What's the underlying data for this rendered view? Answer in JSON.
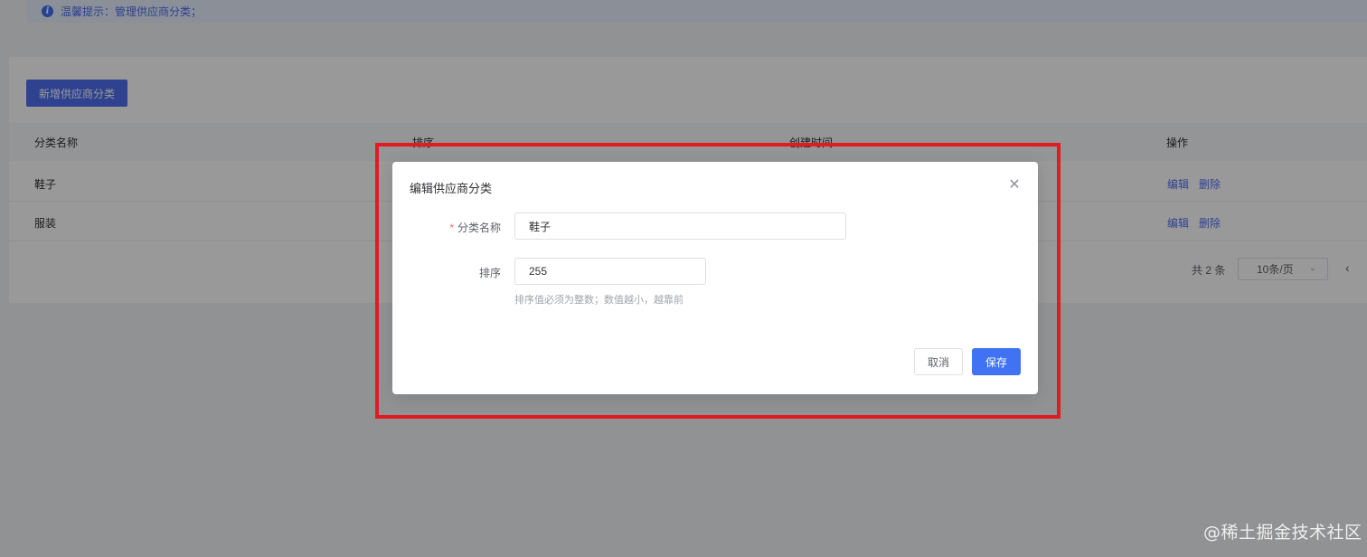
{
  "alert": {
    "text": "温馨提示：管理供应商分类；"
  },
  "toolbar": {
    "add_label": "新增供应商分类"
  },
  "table": {
    "columns": [
      "分类名称",
      "排序",
      "创建时间",
      "操作"
    ],
    "rows": [
      {
        "name": "鞋子",
        "edit": "编辑",
        "delete": "删除"
      },
      {
        "name": "服装",
        "edit": "编辑",
        "delete": "删除"
      }
    ]
  },
  "pagination": {
    "total": "共 2 条",
    "page_size": "10条/页"
  },
  "modal": {
    "title": "编辑供应商分类",
    "name_label": "分类名称",
    "name_value": "鞋子",
    "sort_label": "排序",
    "sort_value": "255",
    "sort_hint": "排序值必须为整数；数值越小，越靠前",
    "cancel_label": "取消",
    "save_label": "保存"
  },
  "watermark": "@稀土掘金技术社区",
  "colors": {
    "primary": "#4072f3",
    "highlight": "#e01b22"
  }
}
